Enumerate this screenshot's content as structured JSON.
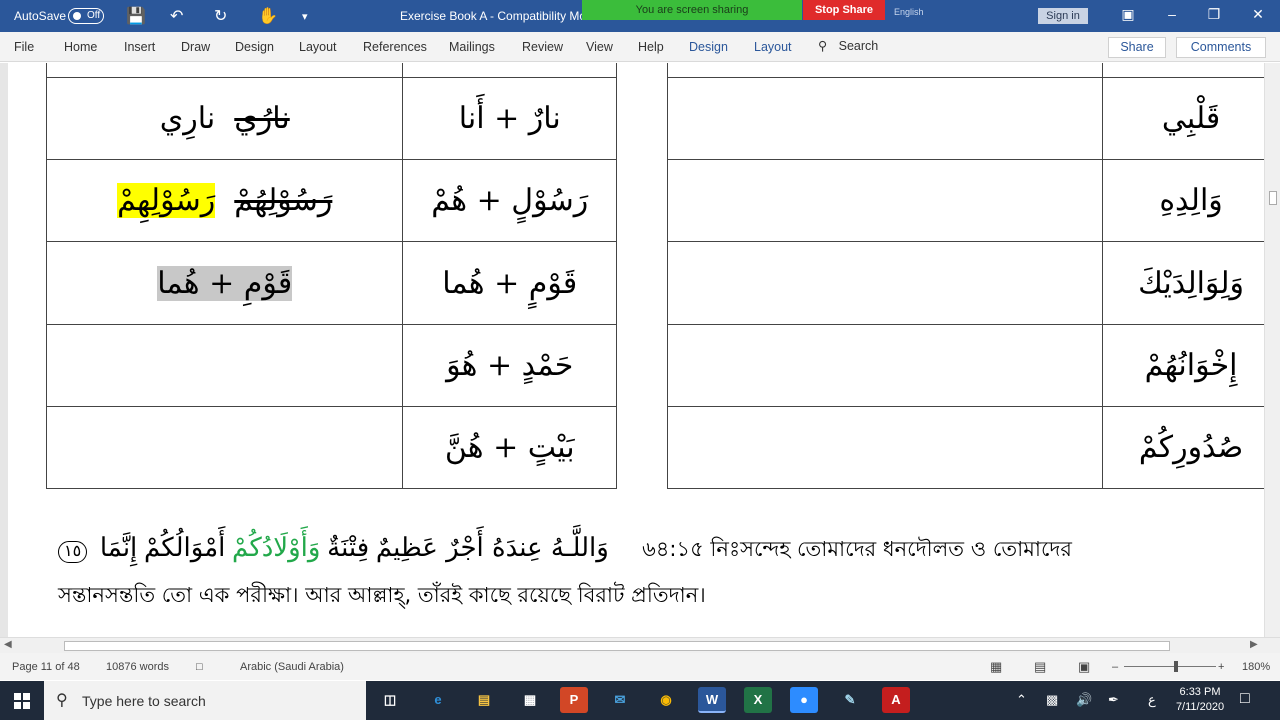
{
  "titlebar": {
    "autosave_label": "AutoSave",
    "autosave_state": "Off",
    "doc_title": "Exercise Book A  -  Compatibility Mo",
    "screen_sharing": "You are screen sharing",
    "stop_share": "Stop Share",
    "language": "English",
    "sign_in": "Sign in"
  },
  "ribbon": {
    "tabs": [
      "File",
      "Home",
      "Insert",
      "Draw",
      "Design",
      "Layout",
      "References",
      "Mailings",
      "Review",
      "View",
      "Help",
      "Design",
      "Layout"
    ],
    "search": "Search",
    "share": "Share",
    "comments": "Comments"
  },
  "left_table": {
    "rows": [
      {
        "result": "نارِي",
        "result_struck": "نارُي",
        "source": "نارٌ + أَنا"
      },
      {
        "result": "رَسُوْلِهِمْ",
        "result_struck": "رَسُوْلِهُمْ",
        "source": "رَسُوْلٍ + هُمْ"
      },
      {
        "result": "قَوْمِ + هُما",
        "result_struck": "",
        "source": "قَوْمٍ + هُما"
      },
      {
        "result": "",
        "result_struck": "",
        "source": "حَمْدٍ + هُوَ"
      },
      {
        "result": "",
        "result_struck": "",
        "source": "بَيْتٍ + هُنَّ"
      }
    ]
  },
  "right_table": {
    "rows": [
      {
        "answer": "",
        "word": "قَلْبِي"
      },
      {
        "answer": "",
        "word": "وَالِدِهِ"
      },
      {
        "answer": "",
        "word": "وَلِوَالِدَيْكَ"
      },
      {
        "answer": "",
        "word": "إِخْوَانُهُمْ"
      },
      {
        "answer": "",
        "word": "صُدُورِكُمْ"
      }
    ]
  },
  "verse": {
    "number": "١٥",
    "arabic_parts": [
      {
        "text": "وَاللَّـهُ عِندَهُ أَجْرٌ عَظِيمٌ",
        "green": false
      },
      {
        "text": "فِتْنَةٌ",
        "green": false
      },
      {
        "text": "وَأَوْلَادُكُمْ",
        "green": false
      },
      {
        "text": "أَمْوَالُكُمْ",
        "green": false
      },
      {
        "text": "إِنَّمَا",
        "green": false
      }
    ],
    "reference": "৬৪:১৫",
    "bengali_line1": "নিঃসন্দেহ তোমাদের ধনদৌলত ও তোমাদের",
    "bengali_line2": "সন্তানসন্ততি তো এক পরীক্ষা। আর আল্লাহ্‌, তাঁরই কাছে রয়েছে বিরাট প্রতিদান।"
  },
  "statusbar": {
    "page": "Page 11 of 48",
    "words": "10876 words",
    "language": "Arabic (Saudi Arabia)",
    "zoom": "180%"
  },
  "taskbar": {
    "search_placeholder": "Type here to search",
    "time": "6:33 PM",
    "date": "7/11/2020",
    "lang": "ع"
  }
}
